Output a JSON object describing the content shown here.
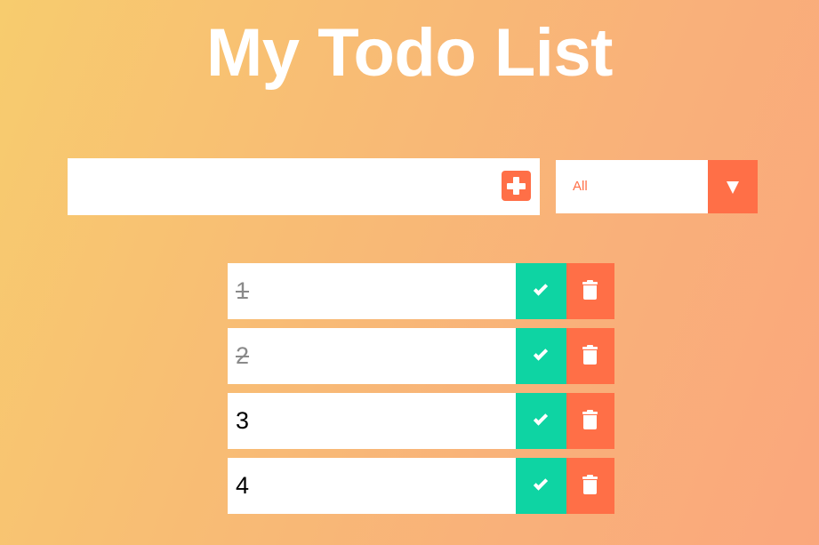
{
  "header": {
    "title": "My Todo List"
  },
  "form": {
    "input_value": "",
    "input_placeholder": "",
    "add_icon": "plus-square-icon",
    "filter": {
      "selected": "All",
      "icon": "caret-down-icon"
    }
  },
  "todos": [
    {
      "text": "1",
      "completed": true
    },
    {
      "text": "2",
      "completed": true
    },
    {
      "text": "3",
      "completed": false
    },
    {
      "text": "4",
      "completed": false
    }
  ],
  "actions": {
    "complete_icon": "check-icon",
    "delete_icon": "trash-icon"
  },
  "colors": {
    "accent": "#ff6f47",
    "complete": "#0ed4a3",
    "background_start": "#f7cc6e",
    "background_end": "#faa77c",
    "completed_text": "#8a8a8a"
  }
}
